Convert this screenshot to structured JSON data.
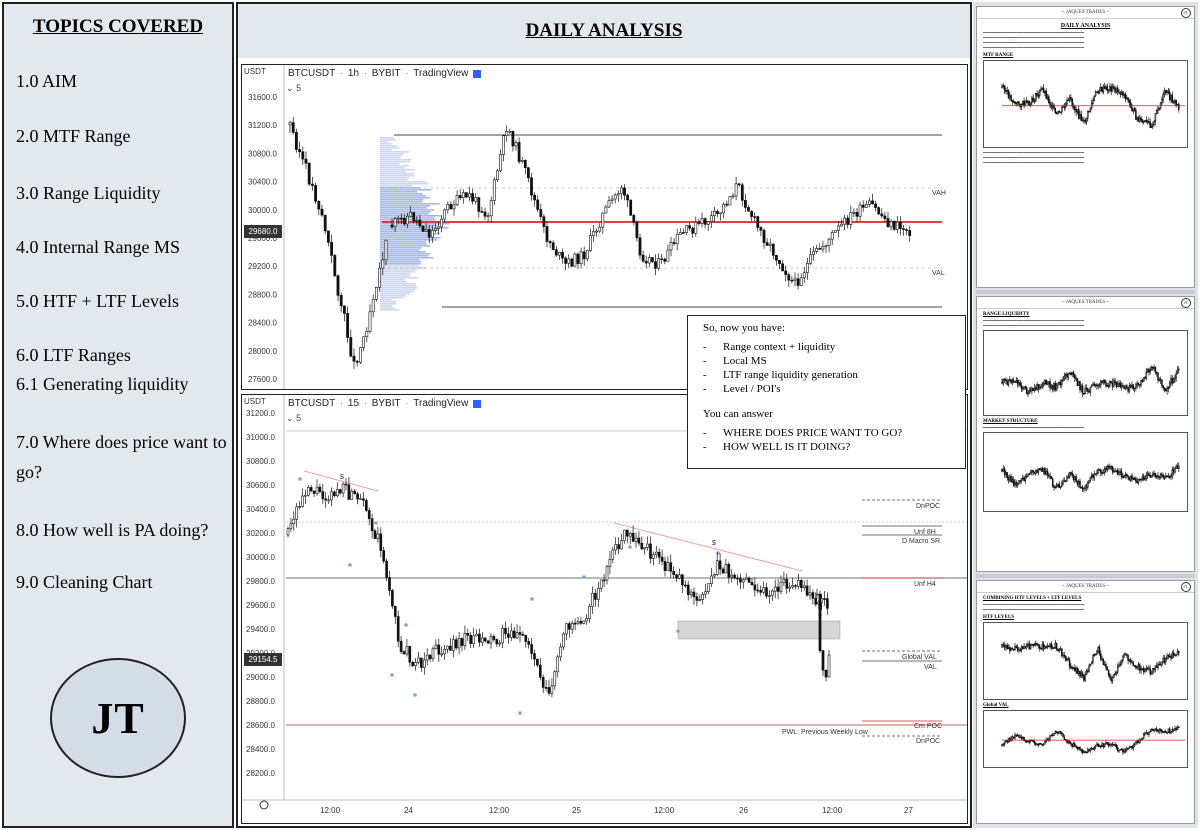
{
  "sidebar": {
    "title": "TOPICS COVERED",
    "topics": [
      "1.0 AIM",
      "2.0 MTF Range",
      "3.0 Range Liquidity",
      "4.0 Internal Range MS",
      "5.0 HTF + LTF Levels",
      "6.0 LTF Ranges",
      "6.1 Generating liquidity",
      "7.0 Where does price want to go?",
      "8.0 How well is PA doing?",
      "9.0 Cleaning Chart"
    ],
    "logo": "JT"
  },
  "main": {
    "title": "DAILY ANALYSIS",
    "chart1": {
      "symbol": "BTCUSDT",
      "interval": "1h",
      "exchange": "BYBIT",
      "platform": "TradingView",
      "currency": "USDT",
      "indicator_count": "5",
      "price_badge": "29680.0",
      "y_ticks": [
        "31600.0",
        "31200.0",
        "30800.0",
        "30400.0",
        "30000.0",
        "29600.0",
        "29200.0",
        "28800.0",
        "28400.0",
        "28000.0",
        "27600.0"
      ],
      "levels": [
        "VAH",
        "VAL"
      ]
    },
    "chart2": {
      "symbol": "BTCUSDT",
      "interval": "15",
      "exchange": "BYBIT",
      "platform": "TradingView",
      "currency": "USDT",
      "indicator_count": "5",
      "price_badge": "29154.5",
      "y_ticks": [
        "31200.0",
        "31000.0",
        "30800.0",
        "30600.0",
        "30400.0",
        "30200.0",
        "30000.0",
        "29800.0",
        "29600.0",
        "29400.0",
        "29200.0",
        "29000.0",
        "28800.0",
        "28600.0",
        "28400.0",
        "28200.0"
      ],
      "x_ticks": [
        "12:00",
        "24",
        "12:00",
        "25",
        "12:00",
        "26",
        "12:00",
        "27"
      ],
      "levels": [
        "DnPOC",
        "Unf 8H",
        "D Macro SR",
        "Unf H4",
        "Global VAL",
        "VAL",
        "Cm POC",
        "PWL: Previous Weekly Low",
        "DnPOC"
      ],
      "annotation": "$"
    },
    "notes": {
      "heading": "So, now you have:",
      "items": [
        "Range context + liquidity",
        "Local MS",
        "LTF range liquidity generation",
        "Level / POI's"
      ],
      "answer_heading": "You can answer",
      "answers": [
        "WHERE DOES PRICE WANT TO GO?",
        "HOW WELL IS IT DOING?"
      ]
    }
  },
  "thumbnails": {
    "pages": [
      {
        "header": "~ JAQUES TRADES ~",
        "title": "DAILY ANALYSIS",
        "sections": [
          "MTF RANGE"
        ]
      },
      {
        "header": "~ JAQUES TRADES ~",
        "sections": [
          "RANGE LIQUIDITY",
          "MARKET STRUCTURE"
        ]
      },
      {
        "header": "~ JAQUES TRADES ~",
        "sections": [
          "COMBINING HTF LEVELS + LTF LEVELS",
          "HTF LEVELS",
          "Global VAL"
        ]
      }
    ]
  }
}
